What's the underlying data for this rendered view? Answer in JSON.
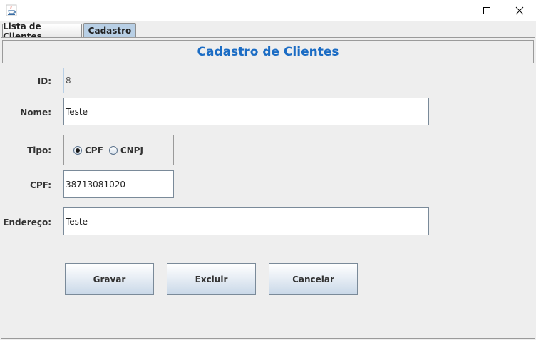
{
  "window": {
    "icon": "java-cup-icon",
    "controls": [
      "minimize-icon",
      "maximize-icon",
      "close-icon"
    ]
  },
  "tabs": [
    {
      "label": "Lista de Clientes",
      "selected": false
    },
    {
      "label": "Cadastro",
      "selected": true
    }
  ],
  "form": {
    "title": "Cadastro de Clientes",
    "title_color": "#1b6cc4",
    "id_label": "ID:",
    "id_value": "8",
    "nome_label": "Nome:",
    "nome_value": "Teste",
    "tipo_label": "Tipo:",
    "tipo_options": [
      {
        "label": "CPF",
        "checked": true
      },
      {
        "label": "CNPJ",
        "checked": false
      }
    ],
    "cpf_label": "CPF:",
    "cpf_value": "38713081020",
    "endereco_label": "Endereço:",
    "endereco_value": "Teste"
  },
  "buttons": {
    "gravar": "Gravar",
    "excluir": "Excluir",
    "cancelar": "Cancelar"
  }
}
